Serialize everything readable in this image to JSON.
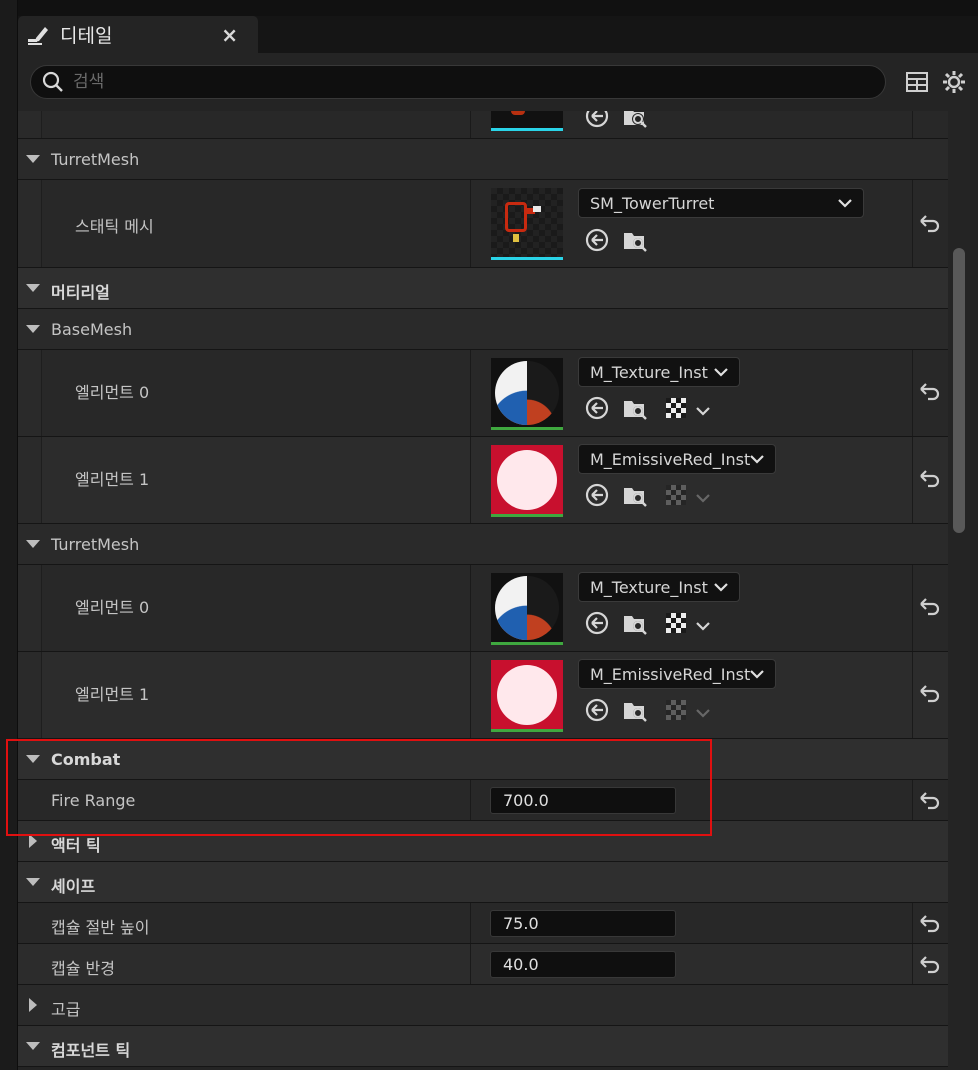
{
  "tab": {
    "title": "디테일",
    "close": "×"
  },
  "search": {
    "placeholder": "검색"
  },
  "sections": {
    "turret_mesh_header": "TurretMesh",
    "static_mesh_label": "스태틱 메시",
    "static_mesh_value": "SM_TowerTurret",
    "materials_header": "머티리얼",
    "base_mesh_header": "BaseMesh",
    "turret_mesh_header2": "TurretMesh",
    "element0": "엘리먼트 0",
    "element1": "엘리먼트 1",
    "mat0": "M_Texture_Inst",
    "mat1": "M_EmissiveRed_Inst",
    "combat_header": "Combat",
    "fire_range_label": "Fire Range",
    "fire_range_value": "700.0",
    "actor_tick_header": "액터 틱",
    "shape_header": "셰이프",
    "capsule_half_height_label": "캡슐 절반 높이",
    "capsule_half_height_value": "75.0",
    "capsule_radius_label": "캡슐 반경",
    "capsule_radius_value": "40.0",
    "advanced_header": "고급",
    "component_tick_header": "컴포넌트 틱"
  },
  "colors": {
    "background": "#242424",
    "highlight": "#e01010",
    "mesh_bar": "#2ad4e8",
    "material_bar": "#3fa83f",
    "emissive_red": "#c8102e"
  }
}
